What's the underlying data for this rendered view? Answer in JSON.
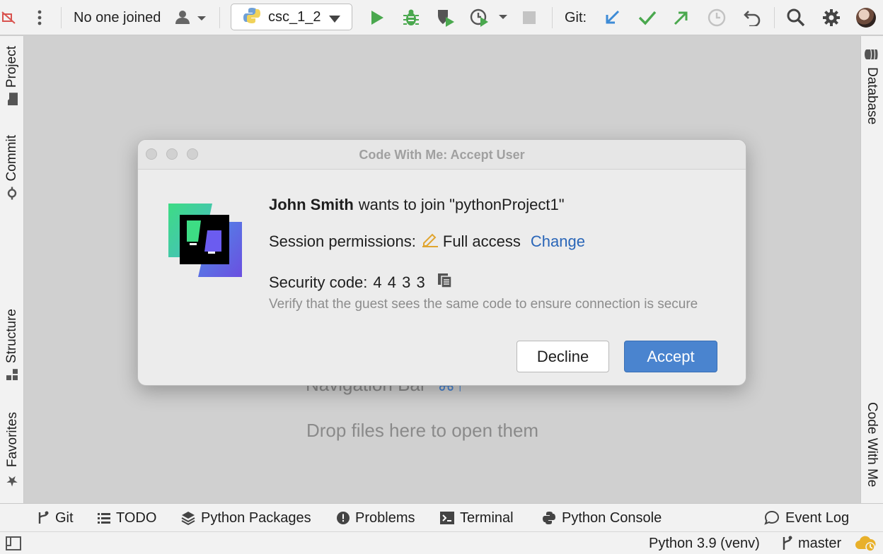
{
  "toolbar": {
    "collab_status": "No one joined",
    "run_config": "csc_1_2",
    "git_label": "Git:"
  },
  "left_tabs": [
    "Project",
    "Commit",
    "Structure",
    "Favorites"
  ],
  "right_tabs": [
    "Database",
    "Code With Me"
  ],
  "editor_hints": {
    "navigation_bar": "Navigation Bar",
    "navigation_shortcut": "⌘↑",
    "drop_files": "Drop files here to open them"
  },
  "dialog": {
    "title": "Code With Me: Accept User",
    "user": "John Smith",
    "join_text": "wants to join \"pythonProject1\"",
    "permissions_label": "Session permissions:",
    "permissions_value": "Full access",
    "change_link": "Change",
    "security_label": "Security code:",
    "security_code": "4 4 3 3",
    "verify_hint": "Verify that the guest sees the same code to ensure connection is secure",
    "decline": "Decline",
    "accept": "Accept"
  },
  "bottom_tabs": [
    "Git",
    "TODO",
    "Python Packages",
    "Problems",
    "Terminal",
    "Python Console",
    "Event Log"
  ],
  "status_bar": {
    "interpreter": "Python 3.9 (venv)",
    "branch": "master"
  },
  "colors": {
    "accent_blue": "#4a84cf",
    "link_blue": "#2a66b8",
    "run_green": "#4aa84e",
    "git_update_blue": "#3d8bd6",
    "git_commit_green": "#4aa84e",
    "editor_bg": "#d0d0d0"
  }
}
